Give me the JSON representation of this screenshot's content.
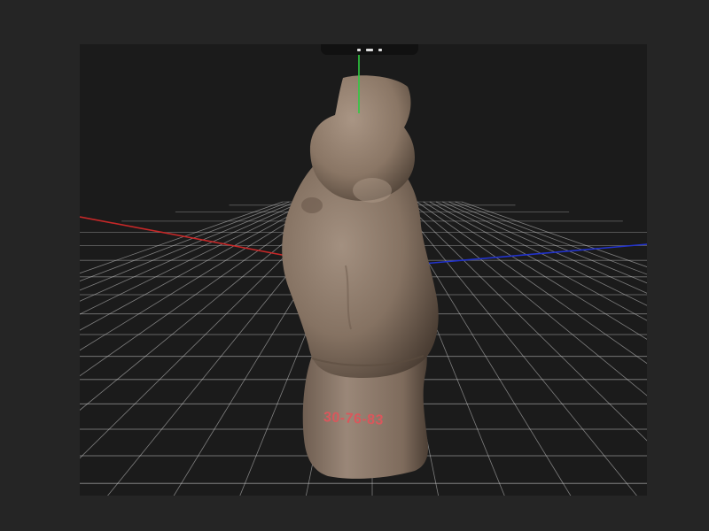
{
  "viewer": {
    "background_color": "#1b1b1b",
    "window_color": "#252525",
    "grid": true,
    "grid_color": "#cfcfcf",
    "axis_colors": {
      "x": "#c62828",
      "y": "#2ecc40",
      "z": "#2233cc"
    }
  },
  "toolbar": {
    "icons": [
      "toolbar-icon",
      "toolbar-icon",
      "toolbar-icon"
    ]
  },
  "model": {
    "label": "30-76-83",
    "label_color": "#d9575c",
    "surface_color": "#8d7a6b"
  }
}
